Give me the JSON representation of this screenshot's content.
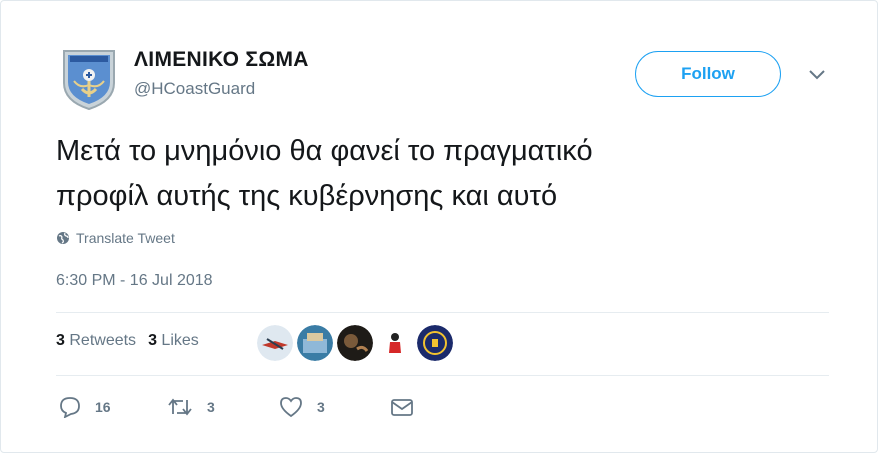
{
  "user": {
    "name": "ΛΙΜΕΝΙΚΟ ΣΩΜΑ",
    "handle": "@HCoastGuard"
  },
  "follow_label": "Follow",
  "tweet": {
    "text_line1": "Μετά το μνημόνιο θα φανεί το πραγματικό",
    "text_line2": "προφίλ αυτής της κυβέρνησης και αυτό",
    "translate_label": "Translate Tweet",
    "timestamp": "6:30 PM - 16 Jul 2018"
  },
  "stats": {
    "retweets_count": "3",
    "retweets_label": "Retweets",
    "likes_count": "3",
    "likes_label": "Likes"
  },
  "actions": {
    "replies": "16",
    "retweets": "3",
    "likes": "3"
  },
  "colors": {
    "accent": "#1da1f2",
    "muted": "#657786",
    "text": "#14171a"
  },
  "icons": [
    "globe-icon",
    "chevron-down-icon",
    "reply-icon",
    "retweet-icon",
    "heart-icon",
    "message-icon"
  ]
}
